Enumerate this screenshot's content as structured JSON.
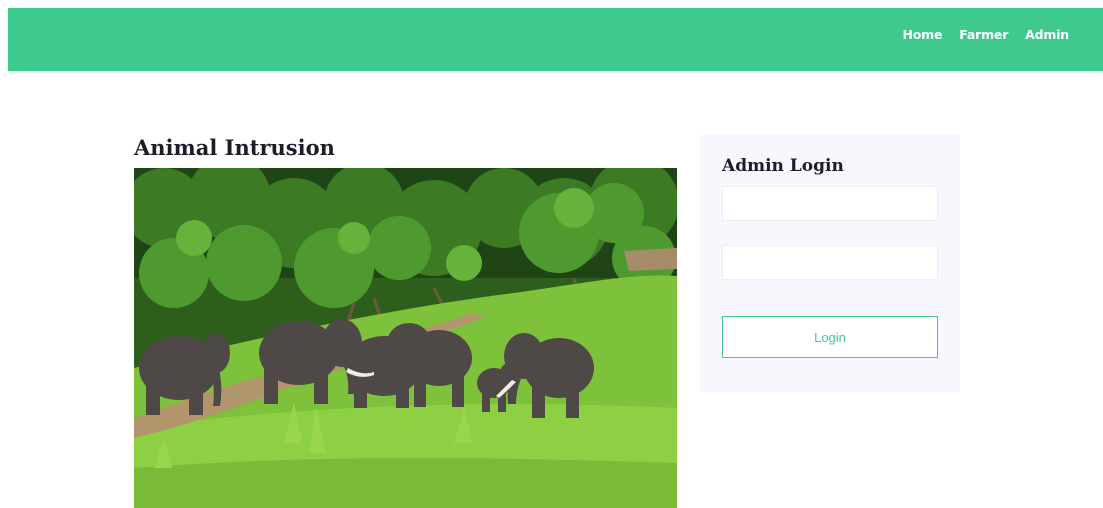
{
  "nav": {
    "links": [
      "Home",
      "Farmer",
      "Admin"
    ]
  },
  "main": {
    "title": "Animal Intrusion",
    "image": {
      "subject": "herd of elephants in green forest clearing"
    }
  },
  "login": {
    "title": "Admin Login",
    "username": {
      "value": "",
      "placeholder": ""
    },
    "password": {
      "value": "",
      "placeholder": ""
    },
    "button_label": "Login"
  },
  "colors": {
    "brand": "#3fc98c",
    "heading": "#1b1d2c",
    "panel_bg": "#f8f7fd"
  }
}
